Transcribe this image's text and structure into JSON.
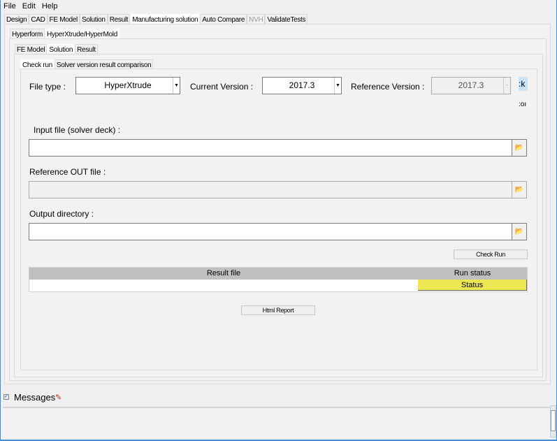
{
  "menu": [
    "File",
    "Edit",
    "Help"
  ],
  "main_tabs": [
    {
      "label": "Design"
    },
    {
      "label": "CAD"
    },
    {
      "label": "FE Model"
    },
    {
      "label": "Solution"
    },
    {
      "label": "Result"
    },
    {
      "label": "Manufacturing solution",
      "active": true
    },
    {
      "label": "Auto Compare"
    },
    {
      "label": "NVH",
      "disabled": true
    },
    {
      "label": "ValidateTests"
    }
  ],
  "sub_tabs": [
    {
      "label": "Hyperform"
    },
    {
      "label": "HyperXtrude/HyperMold",
      "active": true
    }
  ],
  "stage_tabs": [
    {
      "label": "FE Model"
    },
    {
      "label": "Solution",
      "active": true
    },
    {
      "label": "Result"
    }
  ],
  "mode_tabs": [
    {
      "label": "Check run",
      "active": true
    },
    {
      "label": "Solver version result comparison"
    }
  ],
  "form": {
    "file_type_label": "File type :",
    "file_type_value": "HyperXtrude",
    "current_version_label": "Current Version  :",
    "current_version_value": "2017.3",
    "reference_version_label": "Reference Version :",
    "reference_version_value": "2017.3",
    "clipped_button_text": ":k",
    "clipped_label_text": ":oı",
    "input_file_label": "Input file (solver deck) :",
    "input_file_value": "",
    "reference_out_label": "Reference OUT file :",
    "reference_out_value": "",
    "output_dir_label": "Output directory :",
    "output_dir_value": "",
    "check_run_label": "Check Run",
    "html_report_label": "Html Report"
  },
  "table": {
    "columns": [
      "Result file",
      "Run status"
    ],
    "rows": [
      {
        "result_file": "",
        "status": "Status"
      }
    ]
  },
  "messages": {
    "label": "Messages",
    "checked": true
  },
  "colors": {
    "status_yellow": "#ede851",
    "header_gray": "#c0c0c0"
  }
}
